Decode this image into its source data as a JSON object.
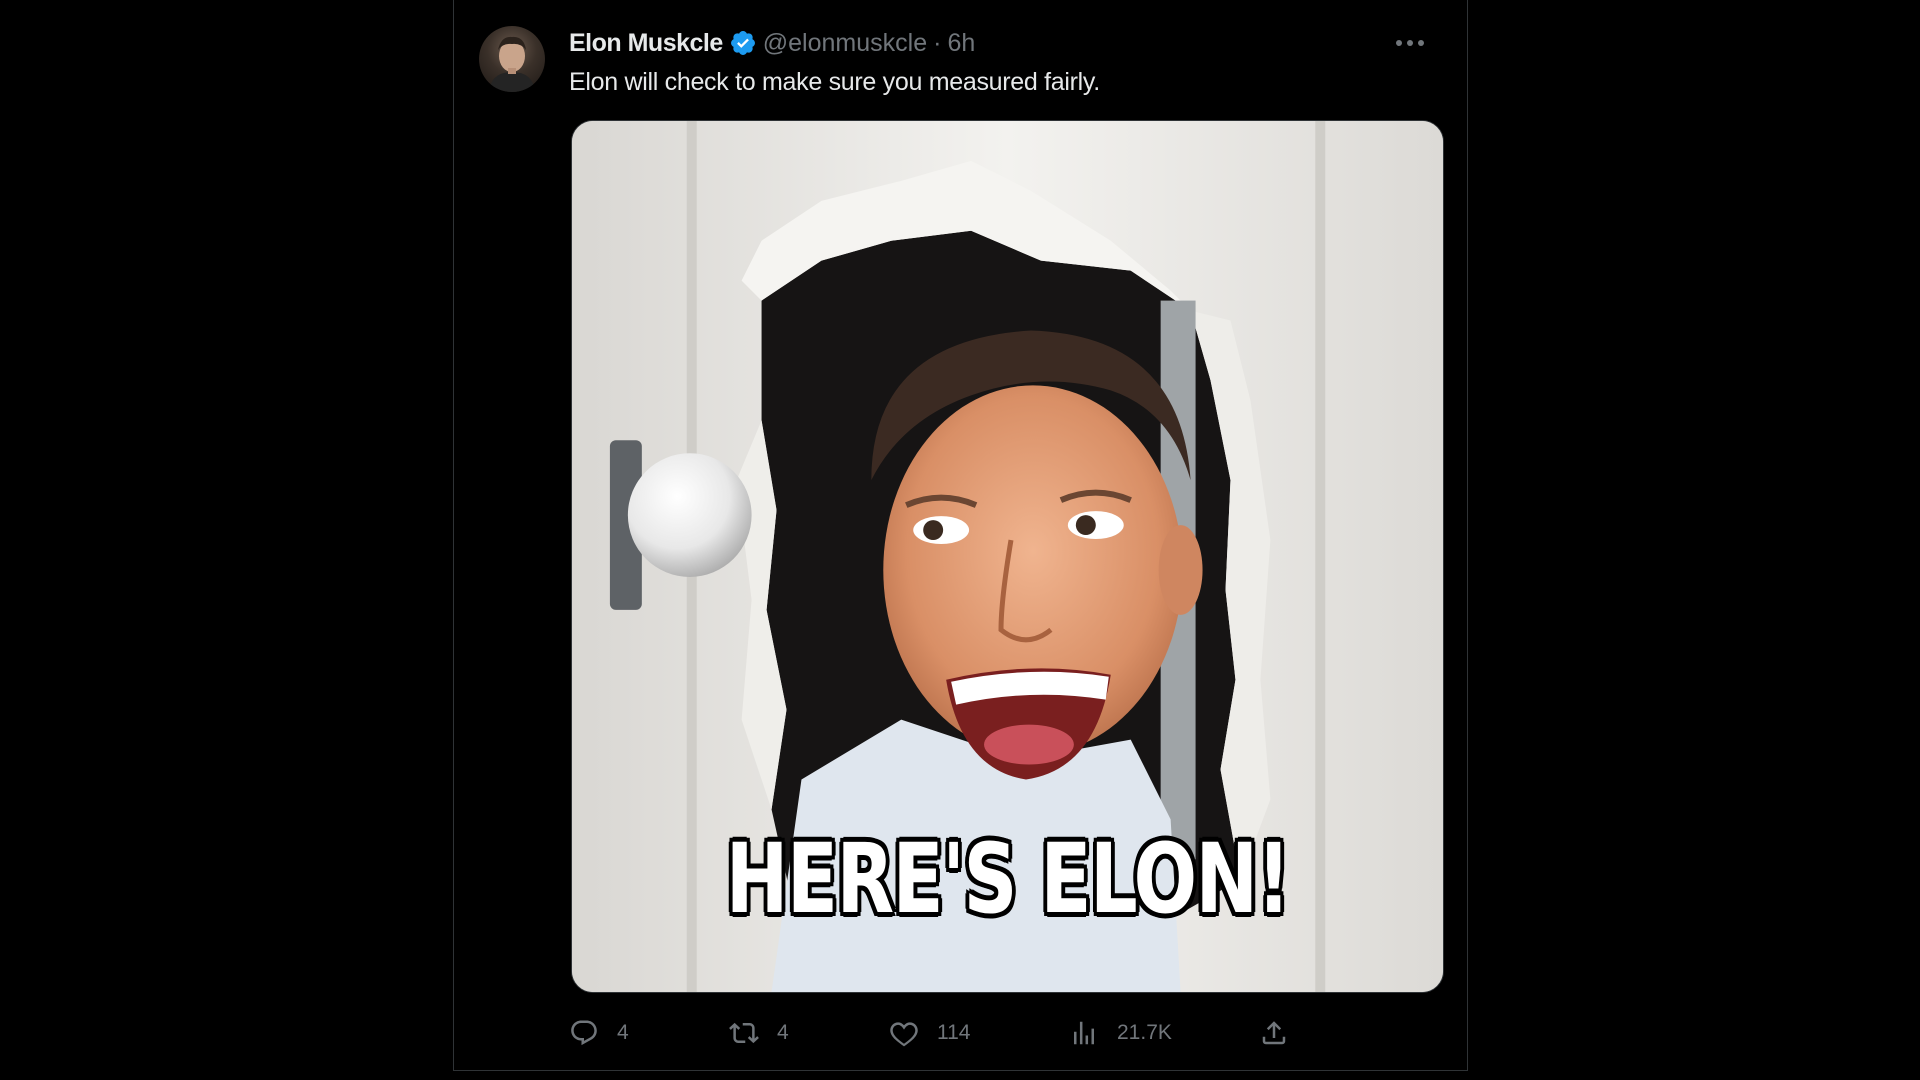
{
  "tweet": {
    "display_name": "Elon Muskcle",
    "handle": "@elonmuskcle",
    "separator": "·",
    "time": "6h",
    "text": "Elon will check to make sure you measured fairly.",
    "media_caption": "HERE'S ELON!",
    "verified": true,
    "avatar_icon": "avatar-photo",
    "more_icon": "more-horizontal-icon"
  },
  "actions": {
    "reply": {
      "icon": "reply-icon",
      "count": "4"
    },
    "retweet": {
      "icon": "retweet-icon",
      "count": "4"
    },
    "like": {
      "icon": "heart-icon",
      "count": "114"
    },
    "views": {
      "icon": "views-icon",
      "count": "21.7K"
    },
    "share": {
      "icon": "share-icon"
    }
  },
  "colors": {
    "background": "#000000",
    "text_primary": "#e7e9ea",
    "text_secondary": "#71767b",
    "verified_blue": "#1d9bf0",
    "border": "#2f3336"
  }
}
